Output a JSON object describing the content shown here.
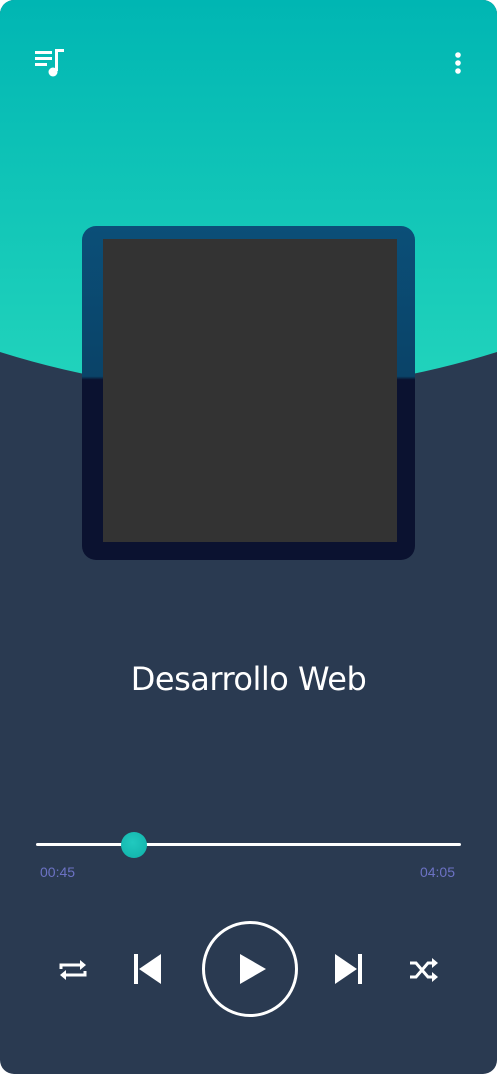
{
  "colors": {
    "teal_top": "#00b8b4",
    "teal_bottom": "#1ed2bb",
    "panel": "#2a3a51",
    "accent_knob": "#1cc3b9",
    "time_text": "#6c72c4"
  },
  "header": {
    "playlist_icon": "playlist-music-icon",
    "menu_icon": "more-vertical-icon"
  },
  "track": {
    "title": "Desarrollo Web",
    "album_art": "album-art-placeholder"
  },
  "progress": {
    "elapsed": "00:45",
    "total": "04:05",
    "fraction": 0.23
  },
  "controls": {
    "repeat_icon": "repeat-icon",
    "previous_icon": "skip-previous-icon",
    "play_icon": "play-icon",
    "next_icon": "skip-next-icon",
    "shuffle_icon": "shuffle-icon"
  }
}
